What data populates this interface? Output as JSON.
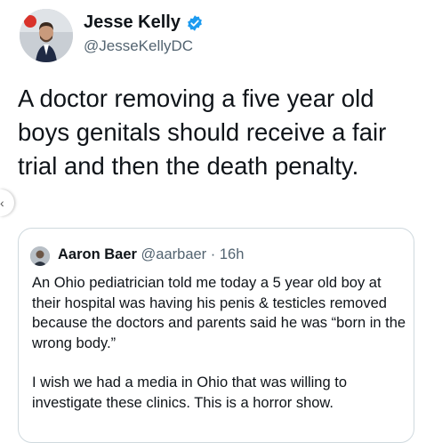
{
  "author": {
    "name": "Jesse Kelly",
    "handle": "@JesseKellyDC"
  },
  "tweet": {
    "text": "A doctor removing a five year old boys genitals should receive a fair trial and then the death penalty."
  },
  "quoted": {
    "name": "Aaron Baer",
    "handle": "@aarbaer",
    "separator": " · ",
    "time": "16h",
    "paragraph1": "An Ohio pediatrician told me today a 5 year old boy at their hospital was having his penis & testicles removed because the doctors and parents said he was “born in the wrong body.”",
    "paragraph2": "I wish we had a media in Ohio that was willing to investigate these clinics. This is a horror show."
  },
  "icons": {
    "verified": "verified-badge-icon",
    "scroll": "chevron-left-icon"
  },
  "colors": {
    "verified": "#1d9bf0",
    "secondary_text": "#536471",
    "border": "#cfd9de"
  }
}
